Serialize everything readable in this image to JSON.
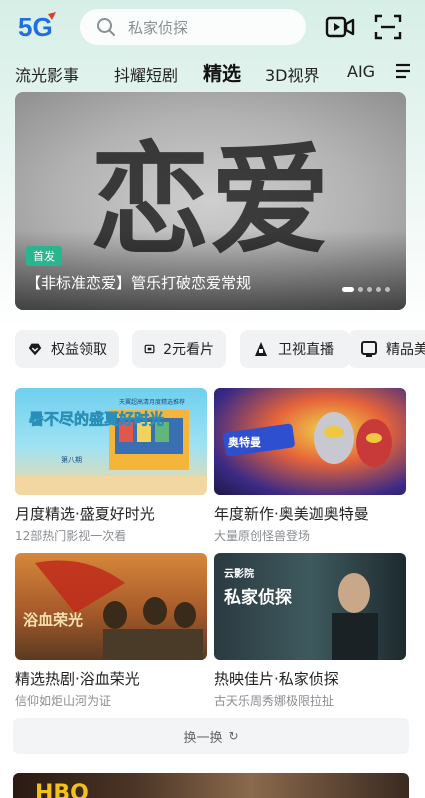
{
  "header": {
    "logo_text": "5G",
    "search_placeholder": "私家侦探"
  },
  "tabs": [
    {
      "label": "流光影事"
    },
    {
      "label": "抖耀短剧"
    },
    {
      "label": "精选"
    },
    {
      "label": "3D视界"
    },
    {
      "label": "AIG"
    }
  ],
  "banner": {
    "badge": "首发",
    "title": "【非标准恋爱】管乐打破恋爱常规",
    "art_text": "恋爱"
  },
  "chips": [
    {
      "label": "权益领取",
      "icon": "heart-diamond-icon"
    },
    {
      "label": "2元看片",
      "icon": "ticket-icon"
    },
    {
      "label": "卫视直播",
      "icon": "broadcast-icon"
    },
    {
      "label": "精品美",
      "icon": "tv-icon"
    }
  ],
  "cards": [
    {
      "title": "月度精选·盛夏好时光",
      "subtitle": "12部热门影视一次看",
      "thumb_text": "暑不尽的盛夏好时光",
      "thumb_sub": "天翼超高清月度精选推荐",
      "thumb_tag": "第八期"
    },
    {
      "title": "年度新作·奥美迦奥特曼",
      "subtitle": "大量原创怪兽登场",
      "thumb_text": "奥特曼"
    },
    {
      "title": "精选热剧·浴血荣光",
      "subtitle": "信仰如炬山河为证",
      "thumb_text": "浴血荣光"
    },
    {
      "title": "热映佳片·私家侦探",
      "subtitle": "古天乐周秀娜极限拉扯",
      "thumb_text": "私家侦探",
      "thumb_brand": "云影院"
    }
  ],
  "refresh_label": "换一换",
  "bottom_banner": {
    "brand": "HBO"
  },
  "colors": {
    "accent_green": "#2bb58f",
    "logo_blue": "#1f6fe0",
    "logo_red": "#e53935",
    "top_gradient": "#d6efe6"
  }
}
